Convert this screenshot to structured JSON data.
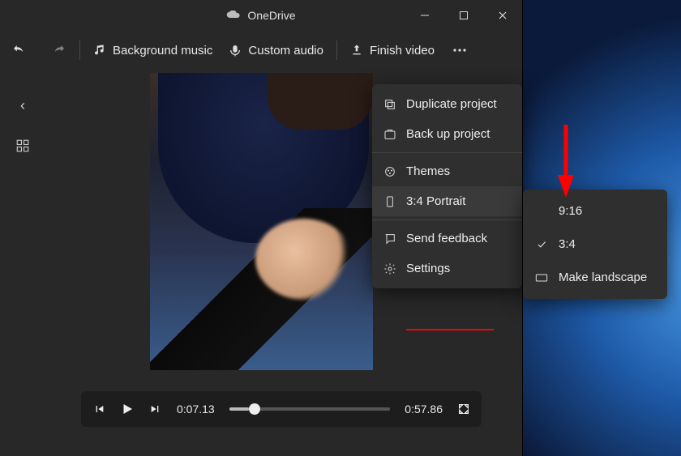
{
  "window": {
    "title": "OneDrive"
  },
  "toolbar": {
    "background_music": "Background music",
    "custom_audio": "Custom audio",
    "finish_video": "Finish video"
  },
  "playback": {
    "current": "0:07.13",
    "total": "0:57.86"
  },
  "menu": {
    "duplicate": "Duplicate project",
    "backup": "Back up project",
    "themes": "Themes",
    "aspect": "3:4 Portrait",
    "feedback": "Send feedback",
    "settings": "Settings"
  },
  "submenu": {
    "r916": "9:16",
    "r34": "3:4",
    "landscape": "Make landscape"
  }
}
